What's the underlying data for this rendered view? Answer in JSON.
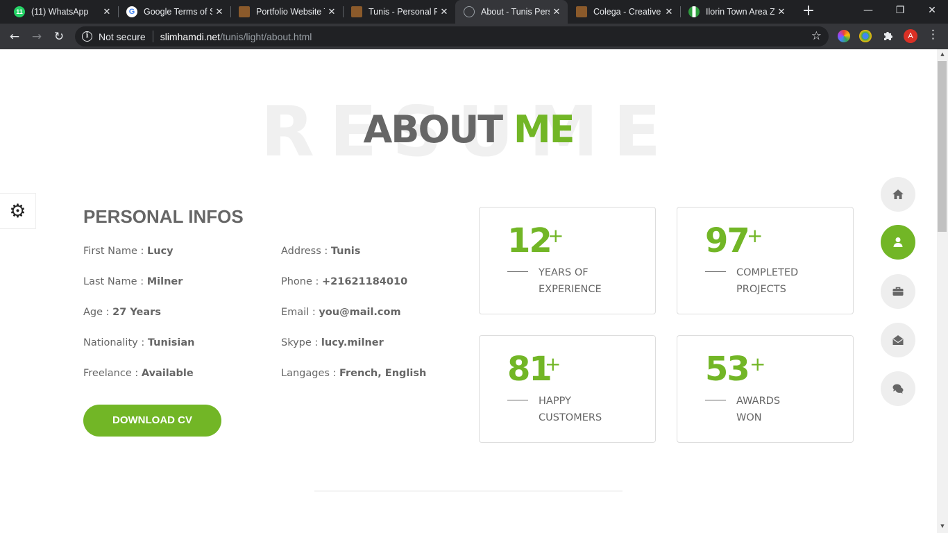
{
  "browser": {
    "tabs": [
      {
        "title": "(11) WhatsApp",
        "favicon_badge": "11",
        "favicon_color": "#25d366"
      },
      {
        "title": "Google Terms of S",
        "favicon_color": "#4285f4"
      },
      {
        "title": "Portfolio Website T",
        "favicon_color": "#8b5a2b"
      },
      {
        "title": "Tunis - Personal Po",
        "favicon_color": "#8b5a2b"
      },
      {
        "title": "About - Tunis Pers",
        "favicon_color": "#9aa0a6",
        "active": true
      },
      {
        "title": "Colega - Creative P",
        "favicon_color": "#8b5a2b"
      },
      {
        "title": "Ilorin Town Area Zi",
        "favicon_color": "#2e9e3e"
      }
    ],
    "new_tab_symbol": "+",
    "window_controls": {
      "minimize": "—",
      "restore": "❐",
      "close": "✕"
    },
    "omnibox": {
      "security_label": "Not secure",
      "url_host": "slimhamdi.net",
      "url_path": "/tunis/light/about.html"
    },
    "profile_initial": "A"
  },
  "page": {
    "bg_title": "RESUME",
    "title_main": "ABOUT",
    "title_accent": "ME",
    "section_heading": "PERSONAL INFOS",
    "personal_infos": {
      "left": [
        {
          "label": "First Name :",
          "value": "Lucy"
        },
        {
          "label": "Last Name :",
          "value": "Milner"
        },
        {
          "label": "Age :",
          "value": "27 Years"
        },
        {
          "label": "Nationality :",
          "value": "Tunisian"
        },
        {
          "label": "Freelance :",
          "value": "Available"
        }
      ],
      "right": [
        {
          "label": "Address :",
          "value": "Tunis"
        },
        {
          "label": "Phone :",
          "value": "+21621184010"
        },
        {
          "label": "Email :",
          "value": "you@mail.com"
        },
        {
          "label": "Skype :",
          "value": "lucy.milner"
        },
        {
          "label": "Langages :",
          "value": "French, English"
        }
      ]
    },
    "download_cv_label": "DOWNLOAD CV",
    "stats": [
      {
        "number": "12",
        "suffix": "+",
        "label_line1": "YEARS OF",
        "label_line2": "EXPERIENCE"
      },
      {
        "number": "97",
        "suffix": "+",
        "label_line1": "COMPLETED",
        "label_line2": "PROJECTS"
      },
      {
        "number": "81",
        "suffix": "+",
        "label_line1": "HAPPY",
        "label_line2": "CUSTOMERS"
      },
      {
        "number": "53",
        "suffix": "+",
        "label_line1": "AWARDS",
        "label_line2": "WON"
      }
    ],
    "side_nav": [
      "home-icon",
      "user-icon",
      "briefcase-icon",
      "envelope-open-icon",
      "comments-icon"
    ],
    "accent_color": "#72b626",
    "text_color": "#666666"
  }
}
